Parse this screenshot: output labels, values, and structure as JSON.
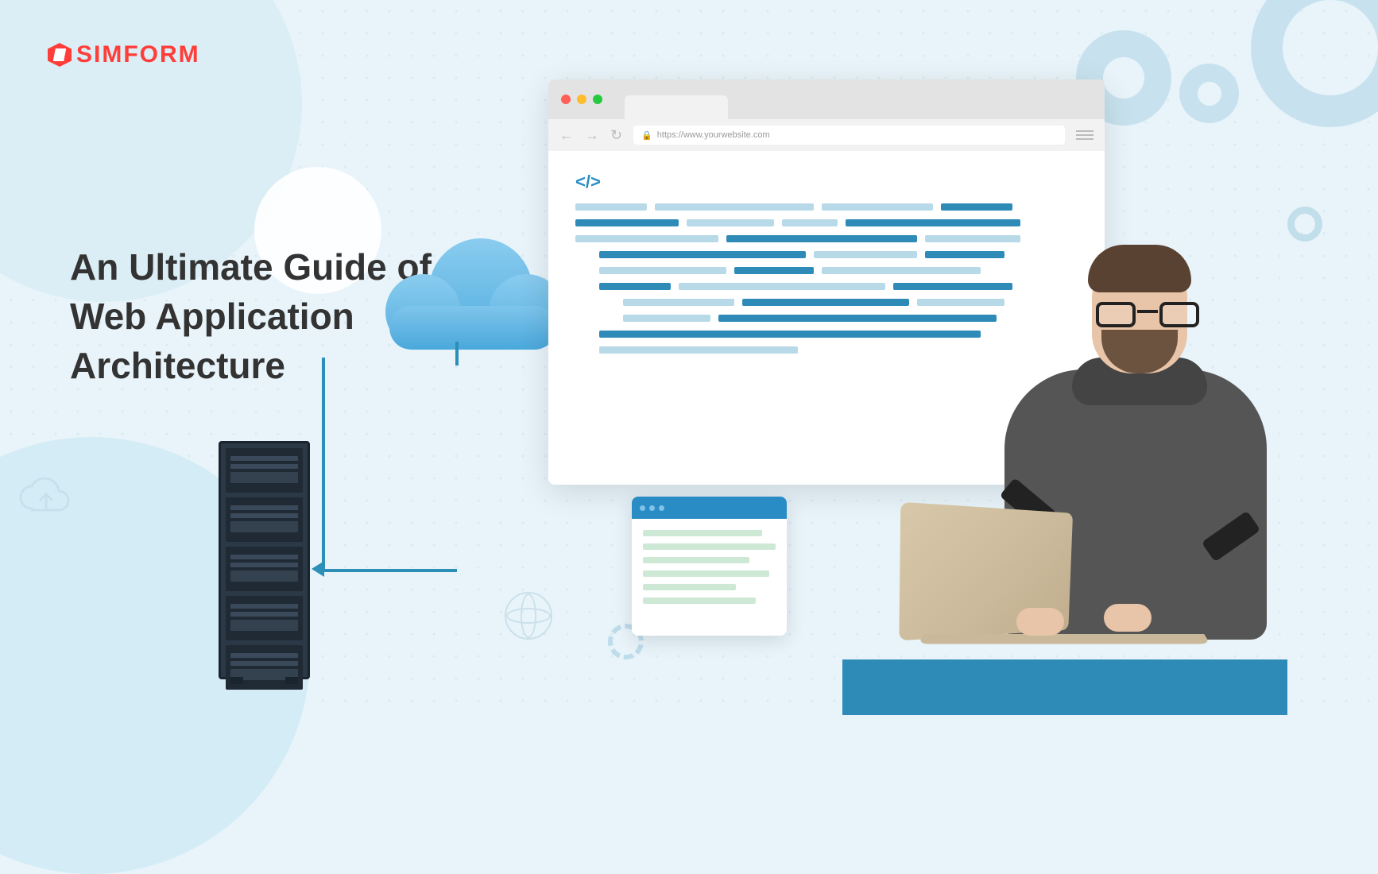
{
  "logo": {
    "text": "SIMFORM"
  },
  "headline": {
    "line1": "An Ultimate Guide of",
    "line2": "Web Application",
    "line3": "Architecture"
  },
  "browser": {
    "url": "https://www.yourwebsite.com",
    "code_icon": "</>"
  },
  "icons": {
    "back": "←",
    "forward": "→",
    "reload": "↻",
    "lock": "🔒"
  }
}
